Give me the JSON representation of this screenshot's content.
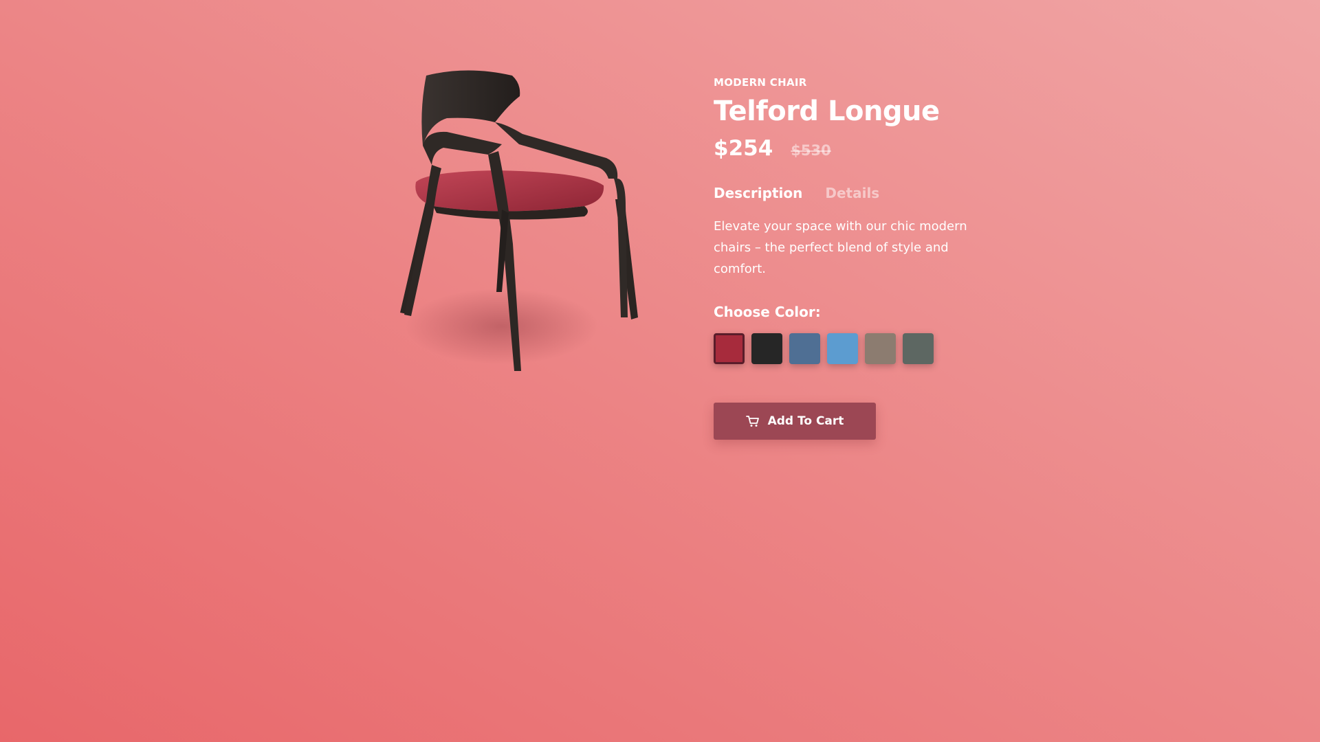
{
  "product": {
    "category": "MODERN CHAIR",
    "title": "Telford Longue",
    "price": "$254",
    "old_price": "$530"
  },
  "tabs": [
    {
      "label": "Description",
      "active": true
    },
    {
      "label": "Details",
      "active": false
    }
  ],
  "description": "Elevate your space with our chic modern chairs – the perfect blend of style and comfort.",
  "color_picker": {
    "label": "Choose Color:",
    "selected_index": 0,
    "swatches": [
      {
        "name": "red",
        "color": "#a72b3c"
      },
      {
        "name": "black",
        "color": "#262626"
      },
      {
        "name": "denim",
        "color": "#4f6f94"
      },
      {
        "name": "sky-blue",
        "color": "#5c9cd0"
      },
      {
        "name": "taupe",
        "color": "#8c7c70"
      },
      {
        "name": "slate-gray",
        "color": "#5d6762"
      }
    ]
  },
  "cart_button": {
    "label": "Add To Cart",
    "icon": "cart-icon"
  },
  "theme": {
    "accent": "#9c4754",
    "text": "#ffffff"
  }
}
